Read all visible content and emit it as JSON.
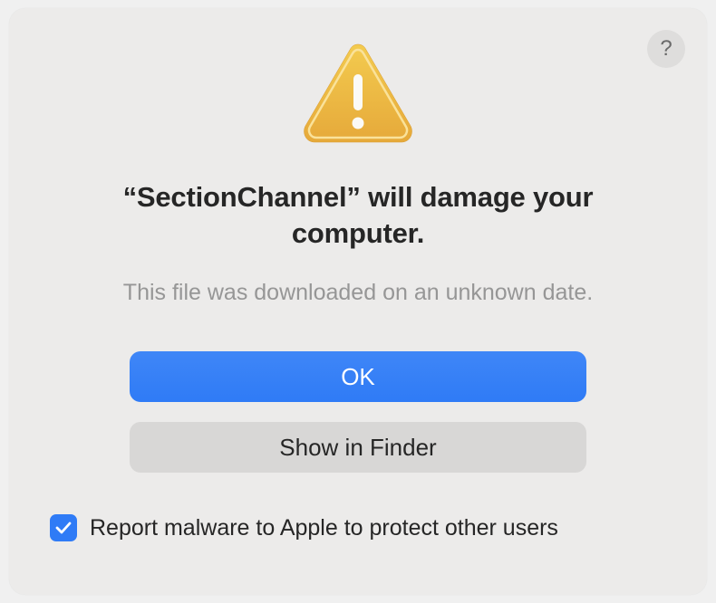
{
  "dialog": {
    "title": "“SectionChannel” will damage your computer.",
    "subtitle": "This file was downloaded on an unknown date.",
    "help_label": "?",
    "buttons": {
      "primary": "OK",
      "secondary": "Show in Finder"
    },
    "checkbox": {
      "checked": true,
      "label": "Report malware to Apple to protect other users"
    }
  }
}
